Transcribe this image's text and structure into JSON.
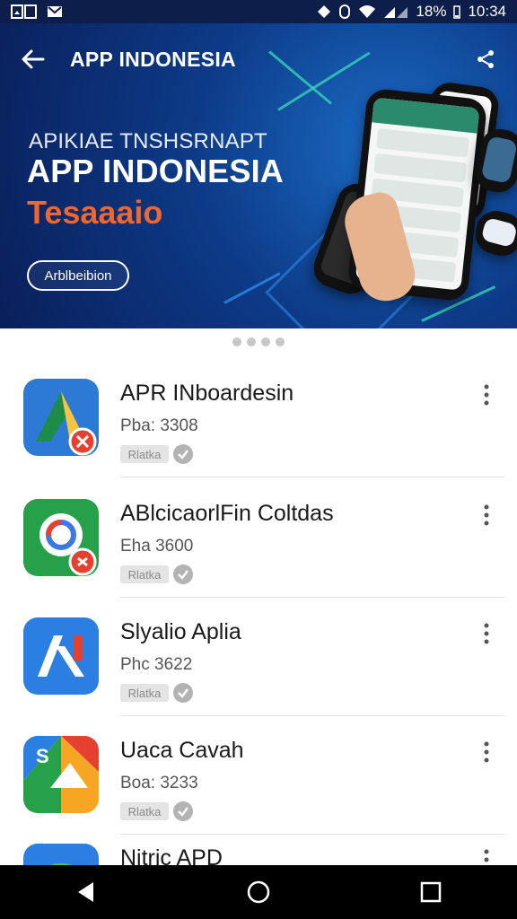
{
  "status_bar": {
    "left_icons": [
      "gallery-icon",
      "mail-icon"
    ],
    "battery": "18%",
    "time": "10:34",
    "icons": [
      "shield-icon",
      "notification-icon",
      "wifi-icon",
      "signal-icon"
    ]
  },
  "app_bar": {
    "title": "APP INDONESIA",
    "back_icon": "back-arrow-icon",
    "share_icon": "share-icon"
  },
  "hero": {
    "subtitle": "APIKIAE TNSHSRNAPT",
    "title": "APP INDONESIA",
    "tagline": "Tesaaaio",
    "button_label": "Arblbeibion",
    "colors": {
      "background": "#0d3a87",
      "tagline": "#f0662f",
      "accent": "#35d3b7"
    }
  },
  "pager": {
    "dots": 4
  },
  "apps": [
    {
      "name": "APR INboardesin",
      "meta": "Pba: 3308",
      "badge": "Rlatka",
      "icon": "yellow-triangle-app-icon"
    },
    {
      "name": "ABlcicaorlFin Coltdas",
      "meta": "Eha 3600",
      "badge": "Rlatka",
      "icon": "google-style-app-icon"
    },
    {
      "name": "Slyalio Aplia",
      "meta": "Phc 3622",
      "badge": "Rlatka",
      "icon": "blue-n-app-icon"
    },
    {
      "name": "Uaca Cavah",
      "meta": "Boa: 3233",
      "badge": "Rlatka",
      "icon": "triangle-s-app-icon"
    },
    {
      "name": "Nitric APD",
      "meta": "",
      "badge": "",
      "icon": "green-cloud-app-icon"
    }
  ],
  "nav_bar": {
    "icons": [
      "back-triangle-icon",
      "home-circle-icon",
      "recents-square-icon"
    ]
  }
}
